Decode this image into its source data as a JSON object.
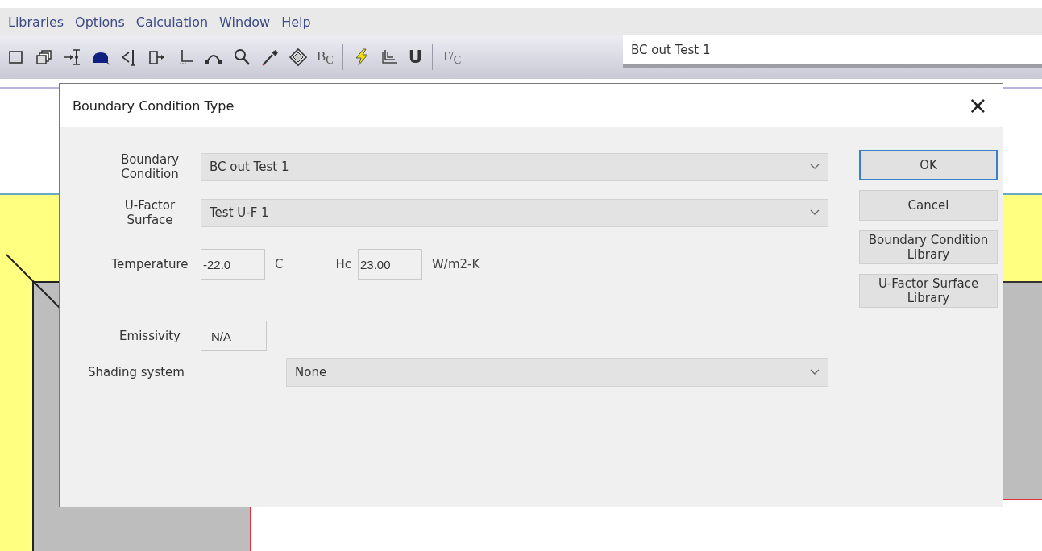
{
  "menu": [
    "Libraries",
    "Options",
    "Calculation",
    "Window",
    "Help"
  ],
  "toolbar": {
    "items": [
      {
        "kind": "icon"
      },
      {
        "kind": "icon"
      },
      {
        "kind": "icon"
      },
      {
        "kind": "icon"
      },
      {
        "kind": "icon"
      },
      {
        "kind": "icon"
      },
      {
        "kind": "icon"
      },
      {
        "kind": "icon"
      },
      {
        "kind": "icon"
      },
      {
        "kind": "icon"
      },
      {
        "kind": "icon"
      },
      {
        "kind": "glyph",
        "label": "B$_{C}$"
      },
      {
        "kind": "separator"
      },
      {
        "kind": "icon"
      },
      {
        "kind": "icon"
      },
      {
        "kind": "glyph",
        "label": "U"
      },
      {
        "kind": "separator"
      },
      {
        "kind": "glyph",
        "label": "T/$_{C}$"
      }
    ],
    "name_field": {
      "value": "BC out Test 1"
    }
  },
  "dialog": {
    "title": "Boundary Condition Type",
    "close": "×",
    "fields": [
      {
        "kind": "combo",
        "label": "Boundary Condition",
        "value": "BC out Test 1"
      },
      {
        "kind": "combo",
        "label": "U-Factor Surface",
        "value": "Test U-F 1"
      },
      {
        "kind": "pair",
        "label": "Temperature",
        "value": "-22.0",
        "unit": "C",
        "label_2": "Hc",
        "value_2": "23.00",
        "unit_2": "W/m2-K"
      },
      {
        "kind": "input",
        "label": "Emissivity",
        "value": "N/A"
      },
      {
        "kind": "combo-wide",
        "label": "Shading system",
        "value": "None"
      }
    ],
    "buttons": [
      {
        "label": "OK",
        "default": true
      },
      {
        "label": "Cancel",
        "default": false
      },
      {
        "label": "Boundary Condition Library",
        "default": false
      },
      {
        "label": "U-Factor Surface Library",
        "default": false
      }
    ]
  }
}
